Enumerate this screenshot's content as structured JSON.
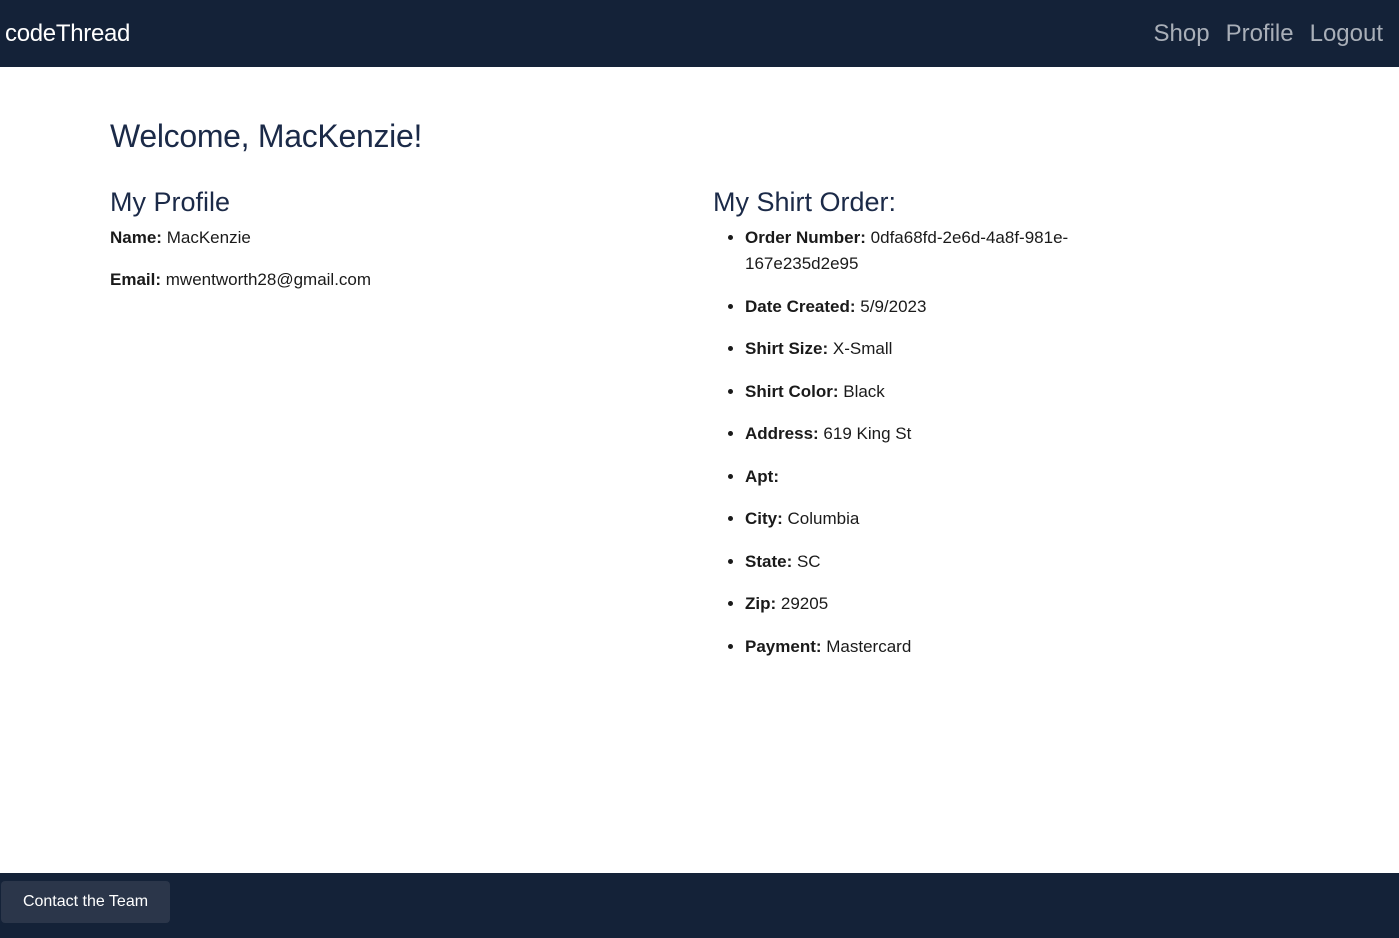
{
  "navbar": {
    "brand": "codeThread",
    "links": [
      "Shop",
      "Profile",
      "Logout"
    ]
  },
  "main": {
    "welcome": "Welcome, MacKenzie!",
    "profile": {
      "title": "My Profile",
      "fields": [
        {
          "label": "Name:",
          "value": "MacKenzie"
        },
        {
          "label": "Email:",
          "value": "mwentworth28@gmail.com"
        }
      ]
    },
    "order": {
      "title": "My Shirt Order:",
      "items": [
        {
          "label": "Order Number:",
          "value": "0dfa68fd-2e6d-4a8f-981e-167e235d2e95"
        },
        {
          "label": "Date Created:",
          "value": "5/9/2023"
        },
        {
          "label": "Shirt Size:",
          "value": "X-Small"
        },
        {
          "label": "Shirt Color:",
          "value": "Black"
        },
        {
          "label": "Address:",
          "value": "619 King St"
        },
        {
          "label": "Apt:",
          "value": ""
        },
        {
          "label": "City:",
          "value": "Columbia"
        },
        {
          "label": "State:",
          "value": "SC"
        },
        {
          "label": "Zip:",
          "value": "29205"
        },
        {
          "label": "Payment:",
          "value": "Mastercard"
        }
      ]
    }
  },
  "footer": {
    "contact_label": "Contact the Team"
  }
}
